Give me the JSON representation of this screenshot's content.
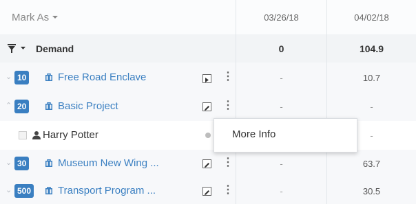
{
  "header": {
    "mark_as_label": "Mark As",
    "dates": [
      "03/26/18",
      "04/02/18"
    ]
  },
  "demand": {
    "label": "Demand",
    "values": [
      "0",
      "104.9"
    ]
  },
  "rows": [
    {
      "badge": "10",
      "name": "Free Road Enclave",
      "values": [
        "-",
        "10.7"
      ],
      "action": "play"
    },
    {
      "badge": "20",
      "name": "Basic Project",
      "values": [
        "-",
        "-"
      ],
      "action": "edit"
    },
    {
      "badge": "30",
      "name": "Museum New Wing ...",
      "values": [
        "-",
        "63.7"
      ],
      "action": "edit"
    },
    {
      "badge": "500",
      "name": "Transport Program ...",
      "values": [
        "-",
        "30.5"
      ],
      "action": "edit"
    }
  ],
  "resource": {
    "name": "Harry Potter",
    "values": [
      "-"
    ]
  },
  "context_menu": {
    "items": [
      "More Info"
    ]
  },
  "colors": {
    "accent": "#3a7fc1",
    "demand_bg": "#f2f4f6",
    "project_bg": "#f7f8fa"
  }
}
